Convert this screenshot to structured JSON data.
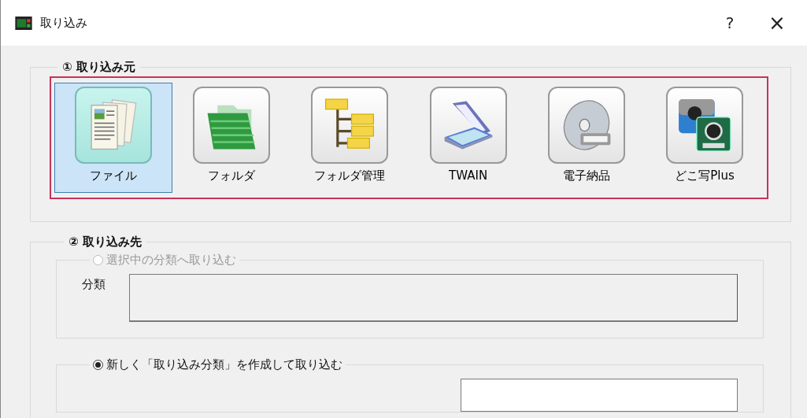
{
  "window": {
    "title": "取り込み",
    "help": "?",
    "close": "×"
  },
  "source_group": {
    "title": "① 取り込み元",
    "items": [
      {
        "label": "ファイル",
        "kind": "file",
        "selected": true
      },
      {
        "label": "フォルダ",
        "kind": "folder",
        "selected": false
      },
      {
        "label": "フォルダ管理",
        "kind": "tree",
        "selected": false
      },
      {
        "label": "TWAIN",
        "kind": "scanner",
        "selected": false
      },
      {
        "label": "電子納品",
        "kind": "disc",
        "selected": false
      },
      {
        "label": "どこ写Plus",
        "kind": "camera",
        "selected": false
      }
    ]
  },
  "destination_group": {
    "title": "② 取り込み先",
    "options": [
      {
        "label": "選択中の分類へ取り込む",
        "selected": false,
        "disabled": true,
        "field_label": "分類"
      },
      {
        "label": "新しく「取り込み分類」を作成して取り込む",
        "selected": true,
        "disabled": false
      }
    ]
  }
}
